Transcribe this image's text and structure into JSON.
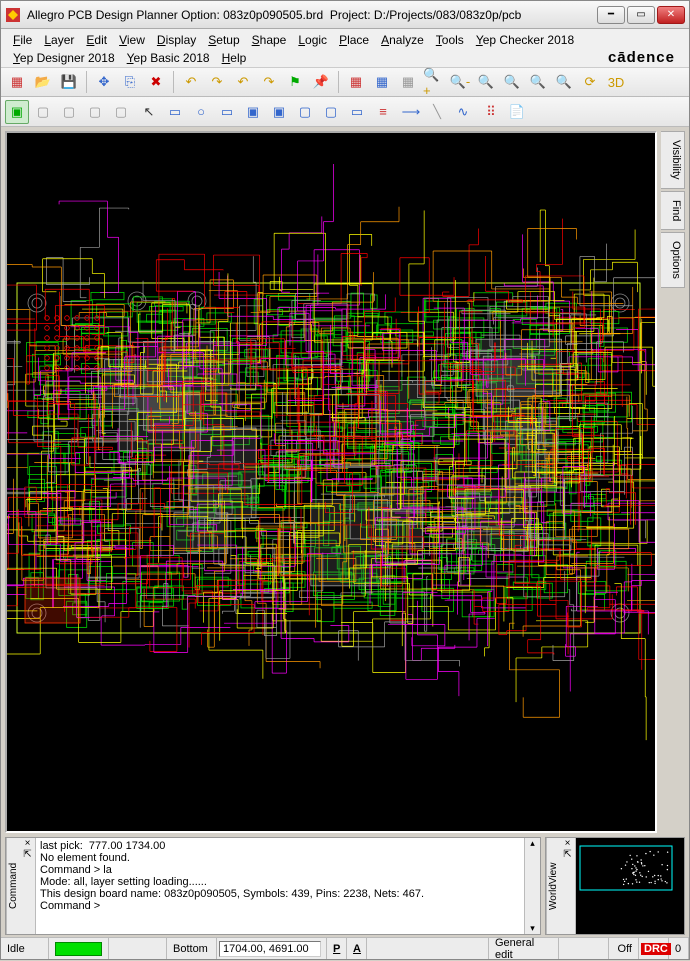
{
  "titlebar": {
    "app_name": "Allegro PCB Design Planner Option",
    "filename": "083z0p090505.brd",
    "project_label": "Project",
    "project_path": "D:/Projects/083/083z0p/pcb"
  },
  "menus": {
    "row1": [
      "File",
      "Layer",
      "Edit",
      "View",
      "Display",
      "Setup",
      "Shape",
      "Logic",
      "Place",
      "Analyze",
      "Tools",
      "Yep Checker 2018"
    ],
    "row2": [
      "Yep Designer 2018",
      "Yep Basic 2018",
      "Help"
    ],
    "brand": "cādence"
  },
  "toolbar1": [
    {
      "name": "new-icon",
      "glyph": "▦",
      "color": "#c33"
    },
    {
      "name": "open-icon",
      "glyph": "📂",
      "color": "#c90"
    },
    {
      "name": "save-icon",
      "glyph": "💾",
      "color": "#36c"
    },
    {
      "name": "sep"
    },
    {
      "name": "move-icon",
      "glyph": "✥",
      "color": "#36c"
    },
    {
      "name": "copy-icon",
      "glyph": "⎘",
      "color": "#36c"
    },
    {
      "name": "delete-icon",
      "glyph": "✖",
      "color": "#c00"
    },
    {
      "name": "sep"
    },
    {
      "name": "undo-icon",
      "glyph": "↶",
      "color": "#c90"
    },
    {
      "name": "redo-icon",
      "glyph": "↷",
      "color": "#c90"
    },
    {
      "name": "undo2-icon",
      "glyph": "↶",
      "color": "#c90"
    },
    {
      "name": "redo2-icon",
      "glyph": "↷",
      "color": "#c90"
    },
    {
      "name": "flag-icon",
      "glyph": "⚑",
      "color": "#0a0"
    },
    {
      "name": "pin-icon",
      "glyph": "📌",
      "color": "#0a0"
    },
    {
      "name": "sep"
    },
    {
      "name": "grid1-icon",
      "glyph": "▦",
      "color": "#c33"
    },
    {
      "name": "grid2-icon",
      "glyph": "▦",
      "color": "#36c"
    },
    {
      "name": "grid3-icon",
      "glyph": "▦",
      "color": "#999"
    },
    {
      "name": "zoomin-icon",
      "glyph": "🔍+",
      "color": "#c90"
    },
    {
      "name": "zoomout-icon",
      "glyph": "🔍-",
      "color": "#c90"
    },
    {
      "name": "zoomfit-icon",
      "glyph": "🔍",
      "color": "#c90"
    },
    {
      "name": "zoomctr-icon",
      "glyph": "🔍",
      "color": "#c90"
    },
    {
      "name": "zoomprev-icon",
      "glyph": "🔍",
      "color": "#c90"
    },
    {
      "name": "zoomsel-icon",
      "glyph": "🔍",
      "color": "#c90"
    },
    {
      "name": "refresh-icon",
      "glyph": "⟳",
      "color": "#c90"
    },
    {
      "name": "3d-icon",
      "glyph": "3D",
      "color": "#c90"
    }
  ],
  "toolbar2": [
    {
      "name": "layer-active-icon",
      "glyph": "▣",
      "color": "#0a0",
      "active": true
    },
    {
      "name": "layer-1-icon",
      "glyph": "▢",
      "color": "#999"
    },
    {
      "name": "layer-2-icon",
      "glyph": "▢",
      "color": "#999"
    },
    {
      "name": "layer-3-icon",
      "glyph": "▢",
      "color": "#999"
    },
    {
      "name": "layer-4-icon",
      "glyph": "▢",
      "color": "#999"
    },
    {
      "name": "sep"
    },
    {
      "name": "cursor-icon",
      "glyph": "↖",
      "color": "#333"
    },
    {
      "name": "rect-icon",
      "glyph": "▭",
      "color": "#36c"
    },
    {
      "name": "circle-icon",
      "glyph": "○",
      "color": "#36c"
    },
    {
      "name": "select-icon",
      "glyph": "▭",
      "color": "#36c"
    },
    {
      "name": "shape1-icon",
      "glyph": "▣",
      "color": "#36c"
    },
    {
      "name": "shape2-icon",
      "glyph": "▣",
      "color": "#36c"
    },
    {
      "name": "shape3-icon",
      "glyph": "▢",
      "color": "#36c"
    },
    {
      "name": "shape4-icon",
      "glyph": "▢",
      "color": "#36c"
    },
    {
      "name": "shape5-icon",
      "glyph": "▭",
      "color": "#36c"
    },
    {
      "name": "layers-icon",
      "glyph": "≡",
      "color": "#c33"
    },
    {
      "name": "sep"
    },
    {
      "name": "route1-icon",
      "glyph": "⟶",
      "color": "#36c"
    },
    {
      "name": "route2-icon",
      "glyph": "╲",
      "color": "#999"
    },
    {
      "name": "route3-icon",
      "glyph": "∿",
      "color": "#36c"
    },
    {
      "name": "sep"
    },
    {
      "name": "meas-icon",
      "glyph": "⠿",
      "color": "#c33"
    },
    {
      "name": "report-icon",
      "glyph": "📄",
      "color": "#c90"
    }
  ],
  "side_tabs": [
    "Visibility",
    "Find",
    "Options"
  ],
  "command": {
    "label": "Command",
    "lines": [
      "last pick:  777.00 1734.00",
      "No element found.",
      "Command > la",
      "Mode: all, layer setting loading......",
      "This design board name: 083z0p090505, Symbols: 439, Pins: 2238, Nets: 467.",
      "Command > "
    ]
  },
  "worldview": {
    "label": "WorldView"
  },
  "status": {
    "idle": "Idle",
    "layer": "Bottom",
    "coords": "1704.00, 4691.00",
    "p": "P",
    "a": "A",
    "mode": "General edit",
    "drill": "Off",
    "drc": "DRC",
    "drc_count": "0"
  }
}
